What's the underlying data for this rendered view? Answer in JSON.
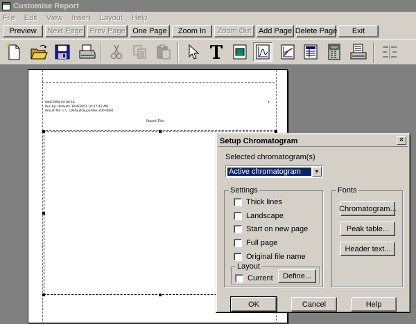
{
  "window": {
    "title": "Customise Report"
  },
  "menu": [
    "File",
    "Edit",
    "View",
    "Insert",
    "Layout",
    "Help"
  ],
  "buttons": [
    {
      "label": "Preview",
      "enabled": true
    },
    {
      "label": "Next Page",
      "enabled": false
    },
    {
      "label": "Prev Page",
      "enabled": false
    },
    {
      "label": "One Page",
      "enabled": true
    },
    {
      "label": "Zoom In",
      "enabled": true
    },
    {
      "label": "Zoom Out",
      "enabled": false
    },
    {
      "label": "Add Page",
      "enabled": true
    },
    {
      "label": "Delete Page",
      "enabled": true
    },
    {
      "label": "Exit",
      "enabled": true
    }
  ],
  "toolbar_icons": [
    "new-page-icon",
    "open-icon",
    "save-icon",
    "print-icon",
    "cut-icon",
    "copy-icon",
    "paste-icon",
    "pointer-icon",
    "text-icon",
    "picture-icon",
    "chromatogram-icon",
    "curve-icon",
    "table-icon",
    "calculator-icon",
    "instrument-icon",
    "align-icon"
  ],
  "page": {
    "header_line1": "UNICORN V4.00.16",
    "header_line2": "Run by: defaults          10/4/2001 10:37:42 AM",
    "header_line3": "Result file: c:\\...\\Default\\Superdex 200-4081",
    "header_page_no": "1",
    "report_title": "Report Title"
  },
  "dialog": {
    "title": "Setup Chromatogram",
    "close_glyph": "×",
    "selected_label": "Selected chromatogram(s)",
    "selected_value": "Active chromatogram",
    "settings_title": "Settings",
    "settings": [
      {
        "label": "Thick lines",
        "checked": false
      },
      {
        "label": "Landscape",
        "checked": false
      },
      {
        "label": "Start on new page",
        "checked": false
      },
      {
        "label": "Full page",
        "checked": false
      },
      {
        "label": "Original file name",
        "checked": false
      }
    ],
    "layout_title": "Layout",
    "layout_current_label": "Current",
    "layout_define_label": "Define...",
    "fonts_title": "Fonts",
    "font_buttons": [
      "Chromatogram...",
      "Peak table...",
      "Header text..."
    ],
    "ok_label": "OK",
    "cancel_label": "Cancel",
    "help_label": "Help"
  },
  "colors": {
    "face": "#d4d0c8",
    "selection": "#0a246a",
    "workspace": "#808080"
  }
}
